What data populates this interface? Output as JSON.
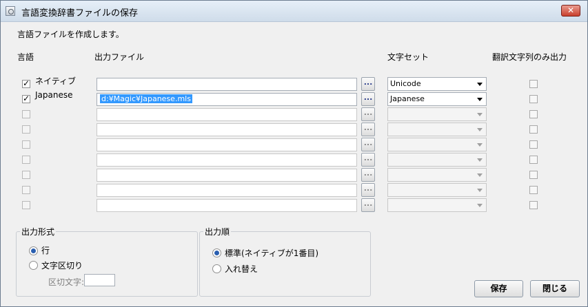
{
  "window": {
    "title": "言語変換辞書ファイルの保存",
    "close_label": "✕"
  },
  "description": "言語ファイルを作成します。",
  "headers": {
    "language": "言語",
    "output_file": "出力ファイル",
    "charset": "文字セット",
    "translated_only": "翻訳文字列のみ出力"
  },
  "rows": [
    {
      "checked": true,
      "enabled": true,
      "language": "ネイティブ",
      "file": "",
      "browse_label": "...",
      "charset": "Unicode"
    },
    {
      "checked": true,
      "enabled": true,
      "language": "Japanese",
      "file": "d:¥Magic¥Japanese.mls",
      "browse_label": "...",
      "charset": "Japanese"
    },
    {
      "checked": false,
      "enabled": false,
      "language": "",
      "file": "",
      "browse_label": "...",
      "charset": ""
    },
    {
      "checked": false,
      "enabled": false,
      "language": "",
      "file": "",
      "browse_label": "...",
      "charset": ""
    },
    {
      "checked": false,
      "enabled": false,
      "language": "",
      "file": "",
      "browse_label": "...",
      "charset": ""
    },
    {
      "checked": false,
      "enabled": false,
      "language": "",
      "file": "",
      "browse_label": "...",
      "charset": ""
    },
    {
      "checked": false,
      "enabled": false,
      "language": "",
      "file": "",
      "browse_label": "...",
      "charset": ""
    },
    {
      "checked": false,
      "enabled": false,
      "language": "",
      "file": "",
      "browse_label": "...",
      "charset": ""
    },
    {
      "checked": false,
      "enabled": false,
      "language": "",
      "file": "",
      "browse_label": "...",
      "charset": ""
    }
  ],
  "output_format": {
    "title": "出力形式",
    "options": [
      "行",
      "文字区切り"
    ],
    "selected": "行",
    "delimiter_label": "区切文字:",
    "delimiter_value": ""
  },
  "output_order": {
    "title": "出力順",
    "options": [
      "標準(ネイティブが1番目)",
      "入れ替え"
    ],
    "selected": "標準(ネイティブが1番目)"
  },
  "buttons": {
    "save": "保存",
    "close": "閉じる"
  }
}
